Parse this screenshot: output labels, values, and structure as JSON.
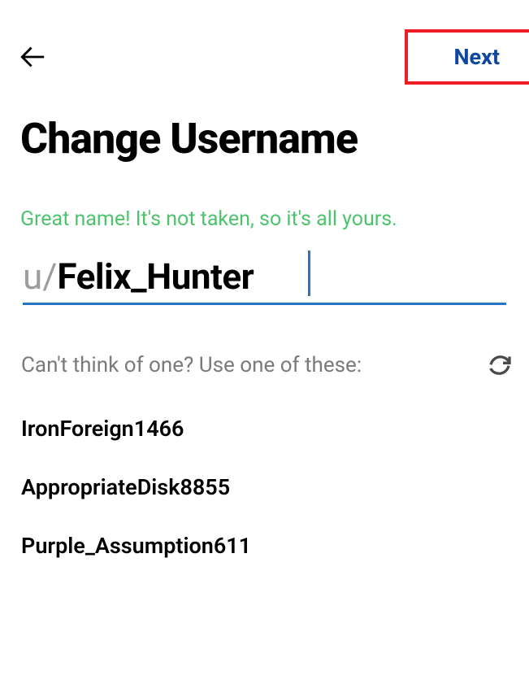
{
  "header": {
    "next_label": "Next"
  },
  "title": "Change Username",
  "status_message": "Great name! It's not taken, so it's all yours.",
  "input": {
    "prefix": "u/",
    "value": "Felix_Hunter"
  },
  "suggestion_label": "Can't think of one? Use one of these:",
  "suggestions": [
    "IronForeign1466",
    "AppropriateDisk8855",
    "Purple_Assumption611"
  ]
}
